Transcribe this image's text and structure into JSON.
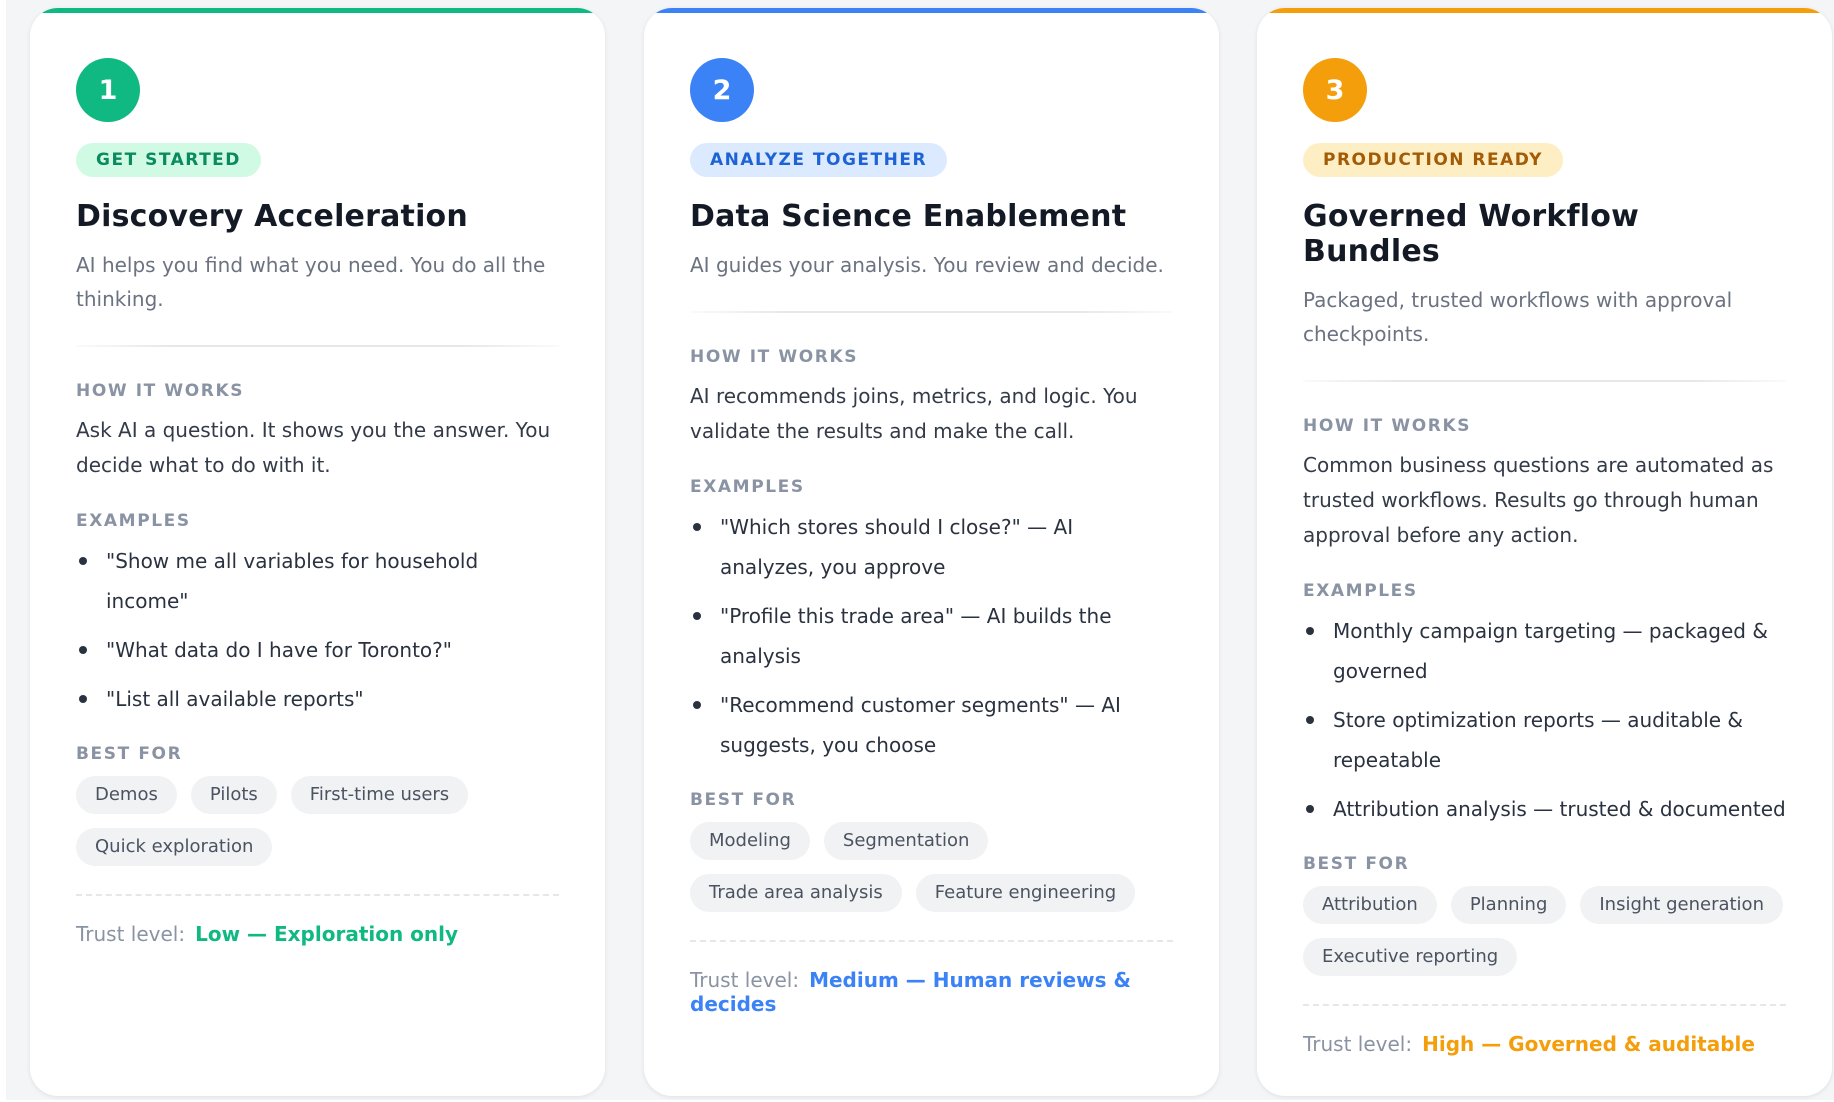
{
  "cards": [
    {
      "number": "1",
      "tag": "GET STARTED",
      "title": "Discovery Acceleration",
      "description": "AI helps you find what you need. You do all the thinking.",
      "how_label": "HOW IT WORKS",
      "how_text": "Ask AI a question. It shows you the answer. You decide what to do with it.",
      "examples_label": "EXAMPLES",
      "examples": [
        "\"Show me all variables for household income\"",
        "\"What data do I have for Toronto?\"",
        "\"List all available reports\""
      ],
      "best_for_label": "BEST FOR",
      "best_for": [
        "Demos",
        "Pilots",
        "First-time users",
        "Quick exploration"
      ],
      "trust_label": "Trust level:",
      "trust_value": "Low — Exploration only",
      "accent": "#10b981"
    },
    {
      "number": "2",
      "tag": "ANALYZE TOGETHER",
      "title": "Data Science Enablement",
      "description": "AI guides your analysis. You review and decide.",
      "how_label": "HOW IT WORKS",
      "how_text": "AI recommends joins, metrics, and logic. You validate the results and make the call.",
      "examples_label": "EXAMPLES",
      "examples": [
        "\"Which stores should I close?\" — AI analyzes, you approve",
        "\"Profile this trade area\" — AI builds the analysis",
        "\"Recommend customer segments\" — AI suggests, you choose"
      ],
      "best_for_label": "BEST FOR",
      "best_for": [
        "Modeling",
        "Segmentation",
        "Trade area analysis",
        "Feature engineering"
      ],
      "trust_label": "Trust level:",
      "trust_value": "Medium — Human reviews & decides",
      "accent": "#3b82f6"
    },
    {
      "number": "3",
      "tag": "PRODUCTION READY",
      "title": "Governed Workflow Bundles",
      "description": "Packaged, trusted workflows with approval checkpoints.",
      "how_label": "HOW IT WORKS",
      "how_text": "Common business questions are automated as trusted workflows. Results go through human approval before any action.",
      "examples_label": "EXAMPLES",
      "examples": [
        "Monthly campaign targeting — packaged & governed",
        "Store optimization reports — auditable & repeatable",
        "Attribution analysis — trusted & documented"
      ],
      "best_for_label": "BEST FOR",
      "best_for": [
        "Attribution",
        "Planning",
        "Insight generation",
        "Executive reporting"
      ],
      "trust_label": "Trust level:",
      "trust_value": "High — Governed & auditable",
      "accent": "#f59e0b"
    }
  ]
}
